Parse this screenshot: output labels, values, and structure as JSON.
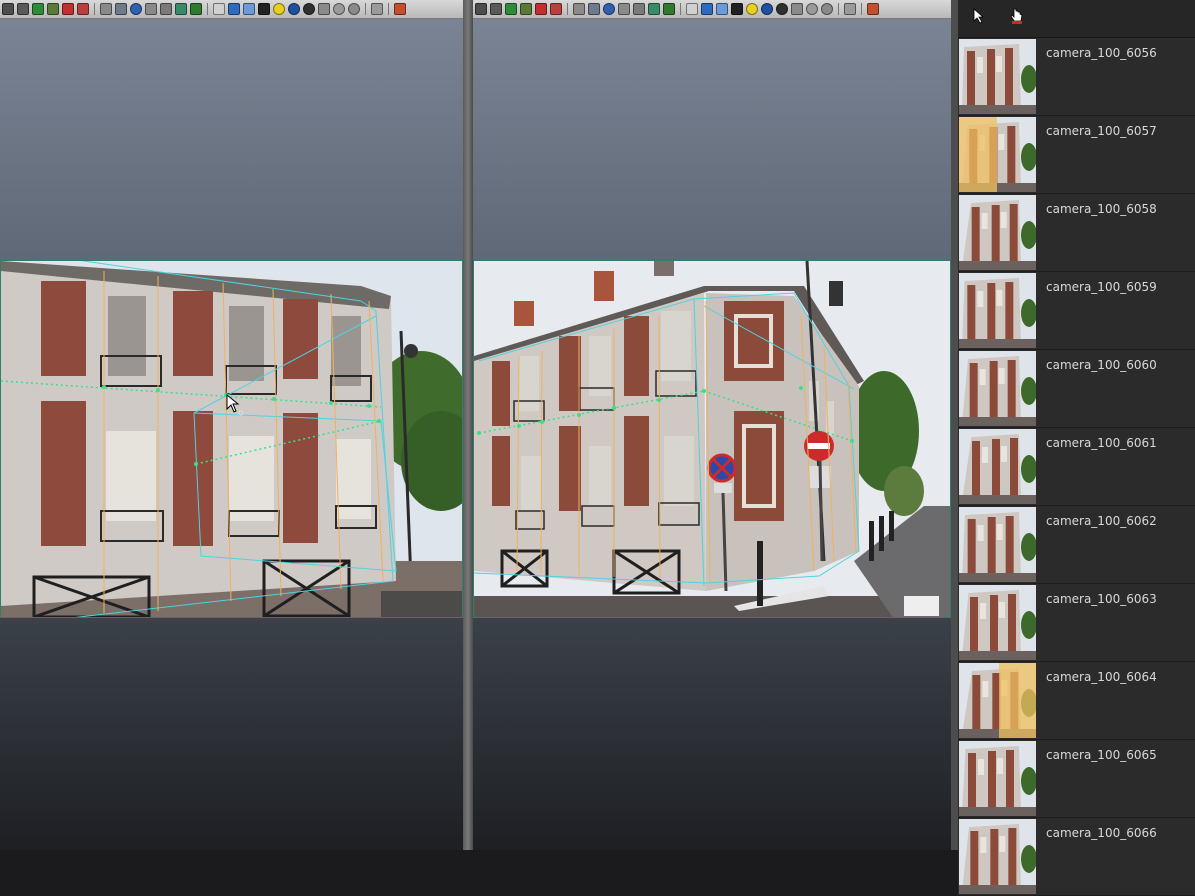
{
  "left_view": {
    "toolbar_icons": [
      "camera-icon",
      "layers-icon",
      "chart-icon",
      "cube-edit-icon",
      "target-icon",
      "eraser-icon",
      "grid-plane-icon",
      "image-plane-icon",
      "sphere-icon",
      "box-icon",
      "cross-box-icon",
      "texture-icon",
      "text-icon",
      "wireframe-cube-icon",
      "solid-cube-icon",
      "shaded-cube-icon",
      "checker-icon",
      "light-icon",
      "sphere-shaded-icon",
      "sphere-dark-icon",
      "dome-icon",
      "hemisphere-icon",
      "half-sphere-icon",
      "cylinder-icon",
      "exit-icon"
    ]
  },
  "right_view": {
    "toolbar_icons": [
      "camera-icon",
      "layers-icon",
      "chart-icon",
      "cube-edit-icon",
      "target-icon",
      "eraser-icon",
      "grid-plane-icon",
      "image-plane-icon",
      "sphere-icon",
      "box-icon",
      "cross-box-icon",
      "texture-icon",
      "text-icon",
      "wireframe-cube-icon",
      "solid-cube-icon",
      "shaded-cube-icon",
      "checker-icon",
      "light-icon",
      "sphere-shaded-icon",
      "sphere-dark-icon",
      "dome-icon",
      "hemisphere-icon",
      "half-sphere-icon",
      "cylinder-icon",
      "exit-icon"
    ]
  },
  "side_panel": {
    "tools": [
      "select-arrow-icon",
      "hand-pointer-icon"
    ],
    "cameras": [
      {
        "label": "camera_100_6056",
        "highlight": false
      },
      {
        "label": "camera_100_6057",
        "highlight": true
      },
      {
        "label": "camera_100_6058",
        "highlight": false
      },
      {
        "label": "camera_100_6059",
        "highlight": false
      },
      {
        "label": "camera_100_6060",
        "highlight": false
      },
      {
        "label": "camera_100_6061",
        "highlight": false
      },
      {
        "label": "camera_100_6062",
        "highlight": false
      },
      {
        "label": "camera_100_6063",
        "highlight": false
      },
      {
        "label": "camera_100_6064",
        "highlight": true
      },
      {
        "label": "camera_100_6065",
        "highlight": false
      },
      {
        "label": "camera_100_6066",
        "highlight": false
      }
    ]
  },
  "colors": {
    "wireframe": "#4fd2e0",
    "edge_lines": "#f0b060",
    "control_points": "#38e08a",
    "brick": "#8e4a3c",
    "stone": "#cfcac6",
    "highlight_overlay": "#f0c060"
  }
}
